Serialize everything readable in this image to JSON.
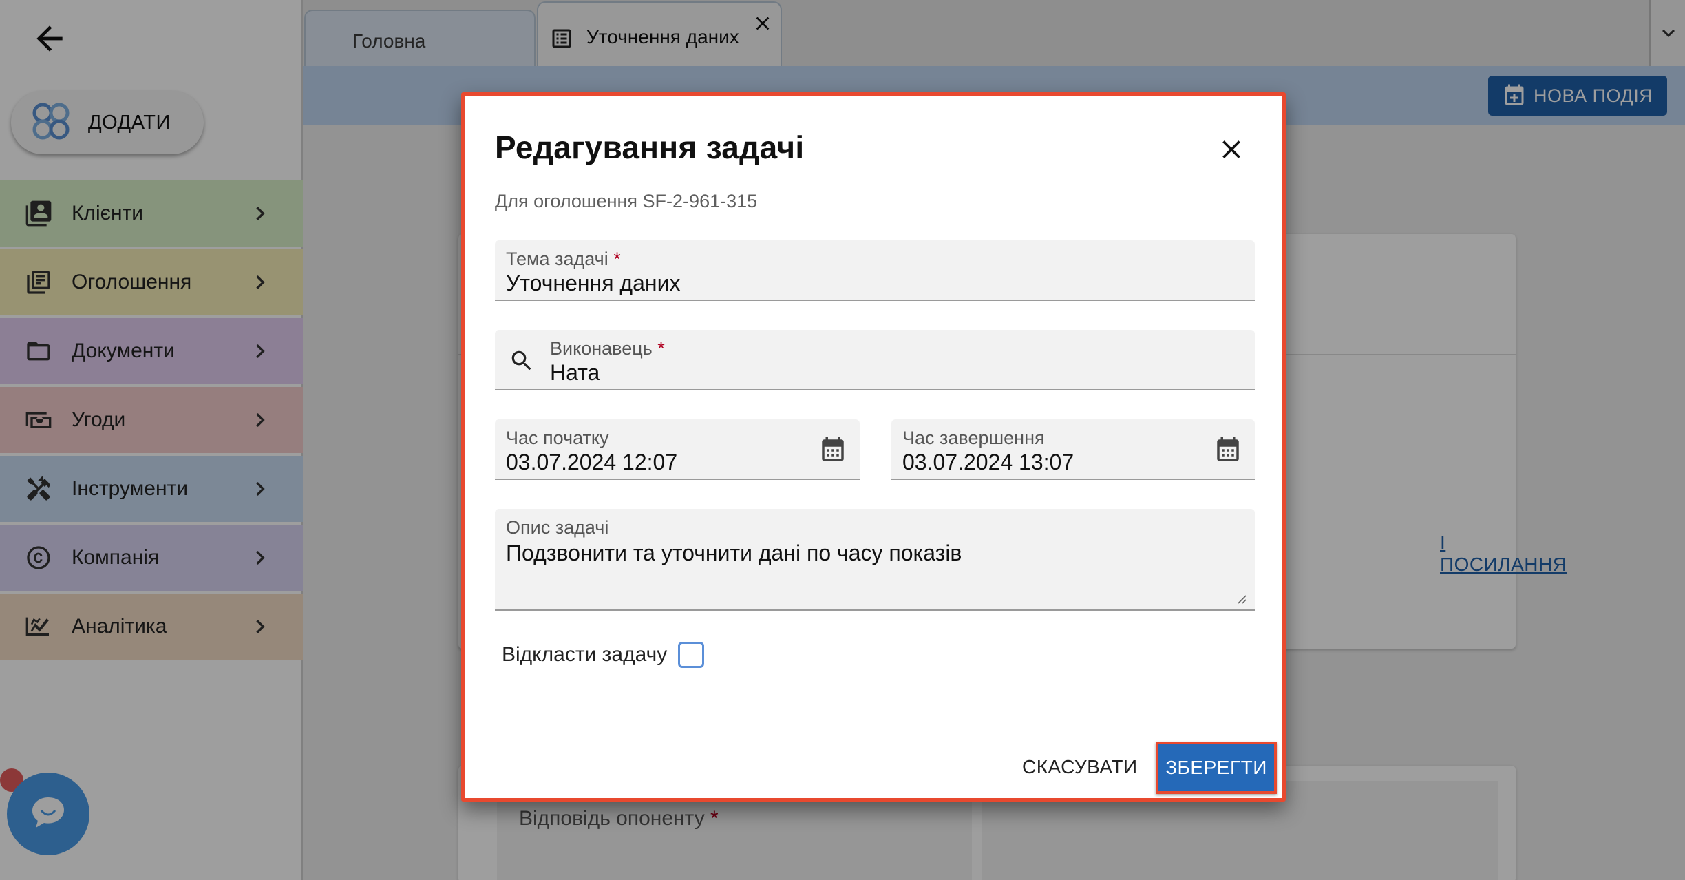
{
  "sidebar": {
    "add_label": "ДОДАТИ",
    "items": [
      {
        "label": "Клієнти",
        "icon": "contacts-icon",
        "color": "#d8efc9"
      },
      {
        "label": "Оголошення",
        "icon": "listing-icon",
        "color": "#f5edb8"
      },
      {
        "label": "Документи",
        "icon": "folder-icon",
        "color": "#e2cdf0"
      },
      {
        "label": "Угоди",
        "icon": "money-icon",
        "color": "#f3cccc"
      },
      {
        "label": "Інструменти",
        "icon": "tools-icon",
        "color": "#c9dcf3"
      },
      {
        "label": "Компанія",
        "icon": "copyright-icon",
        "color": "#d9d4f2"
      },
      {
        "label": "Аналітика",
        "icon": "analytics-icon",
        "color": "#f2dcc5"
      }
    ]
  },
  "tabs": [
    {
      "label": "Головна"
    },
    {
      "label": "Уточнення даних"
    }
  ],
  "toolbar": {
    "new_event_label": "НОВА ПОДІЯ"
  },
  "background": {
    "link_label": "І ПОСИЛАННЯ",
    "opponent_label": "Відповідь опоненту",
    "required_mark": "*"
  },
  "dialog": {
    "title": "Редагування задачі",
    "subtitle": "Для оголошення SF-2-961-315",
    "topic": {
      "label": "Тема задачі",
      "value": "Уточнення даних"
    },
    "executor": {
      "label": "Виконавець",
      "value": "Ната"
    },
    "start": {
      "label": "Час початку",
      "value": "03.07.2024 12:07"
    },
    "end": {
      "label": "Час завершення",
      "value": "03.07.2024 13:07"
    },
    "description": {
      "label": "Опис задачі",
      "value": "Подзвонити та уточнити дані по часу показів"
    },
    "postpone_label": "Відкласти задачу",
    "postpone_checked": false,
    "cancel_label": "СКАСУВАТИ",
    "save_label": "ЗБЕРЕГТИ",
    "required_mark": "*"
  },
  "colors": {
    "accent": "#2569b8",
    "highlight": "#e8492f",
    "required": "#b00020"
  }
}
